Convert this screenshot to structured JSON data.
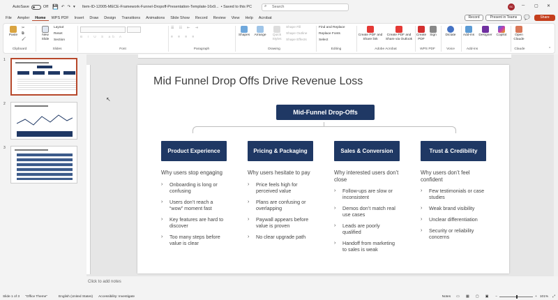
{
  "titlebar": {
    "autosave": "AutoSave",
    "autosave_state": "Off",
    "filename": "Item-ID-12005-MECE-Framework-Funnel-Dropoff-Presentation-Template-16x9...",
    "saved": "• Saved to this PC",
    "search_placeholder": "Search",
    "avatar": "SC"
  },
  "tabs": [
    "File",
    "Ampler",
    "Home",
    "WPS PDF",
    "Insert",
    "Draw",
    "Design",
    "Transitions",
    "Animations",
    "Slide Show",
    "Record",
    "Review",
    "View",
    "Help",
    "Acrobat"
  ],
  "tab_active": "Home",
  "actions": {
    "record": "Record",
    "teams": "Present in Teams",
    "share": "Share"
  },
  "ribbon": {
    "clipboard": {
      "label": "Clipboard",
      "paste": "Paste"
    },
    "slides": {
      "label": "Slides",
      "new_slide": "New Slide",
      "layout": "Layout",
      "reset": "Reset",
      "section": "Section"
    },
    "font": {
      "label": "Font"
    },
    "paragraph": {
      "label": "Paragraph"
    },
    "drawing": {
      "label": "Drawing",
      "shapes": "Shapes",
      "arrange": "Arrange",
      "quick_styles": "Quick Styles",
      "shape_fill": "Shape Fill",
      "shape_outline": "Shape Outline",
      "shape_effects": "Shape Effects"
    },
    "editing": {
      "label": "Editing",
      "find": "Find and Replace",
      "replace_fonts": "Replace Fonts",
      "select": "Select"
    },
    "acrobat": {
      "label": "Adobe Acrobat",
      "create_share": "Create PDF and Share link",
      "create_outlook": "Create PDF and Share via Outlook"
    },
    "wps": {
      "label": "WPS PDF",
      "create_pdf": "Create PDF",
      "sign": "Sign"
    },
    "voice": {
      "label": "Voice",
      "dictate": "Dictate"
    },
    "addins": {
      "label": "Add-ins",
      "addins": "Add-ins",
      "designer": "Designer",
      "copilot": "Copilot"
    },
    "claude": {
      "label": "Claude",
      "open": "Open Claude"
    }
  },
  "slide": {
    "title": "Mid Funnel Drop Offs Drive Revenue Loss",
    "top_box": "Mid-Funnel Drop-Offs",
    "columns": [
      {
        "head": "Product Experience",
        "sub": "Why users stop engaging",
        "bullets": [
          "Onboarding is long or confusing",
          "Users don’t reach a “wow” moment fast",
          "Key features are hard to discover",
          "Too many steps before value is clear"
        ]
      },
      {
        "head": "Pricing & Packaging",
        "sub": "Why users hesitate to pay",
        "bullets": [
          "Price feels high for perceived value",
          "Plans are confusing or overlapping",
          "Paywall appears before value is proven",
          "No clear upgrade path"
        ]
      },
      {
        "head": "Sales & Conversion",
        "sub": "Why interested users don’t close",
        "bullets": [
          "Follow-ups are slow or inconsistent",
          "Demos don’t match real use cases",
          "Leads are poorly qualified",
          "Handoff from marketing to sales is weak"
        ]
      },
      {
        "head": "Trust & Credibility",
        "sub": "Why users don’t feel confident",
        "bullets": [
          "Few testimonials or case studies",
          "Weak brand visibility",
          "Unclear differentiation",
          "Security or reliability concerns"
        ]
      }
    ]
  },
  "thumbnails": [
    {
      "num": "1",
      "selected": true
    },
    {
      "num": "2",
      "selected": false
    },
    {
      "num": "3",
      "selected": false
    }
  ],
  "notes_placeholder": "Click to add notes",
  "status": {
    "slide": "Slide 1 of 3",
    "theme": "\"Office Theme\"",
    "language": "English (United States)",
    "accessibility": "Accessibility: Investigate",
    "notes": "Notes",
    "zoom": "101%"
  },
  "colors": {
    "accent": "#b7472a",
    "navy": "#1f3864"
  }
}
